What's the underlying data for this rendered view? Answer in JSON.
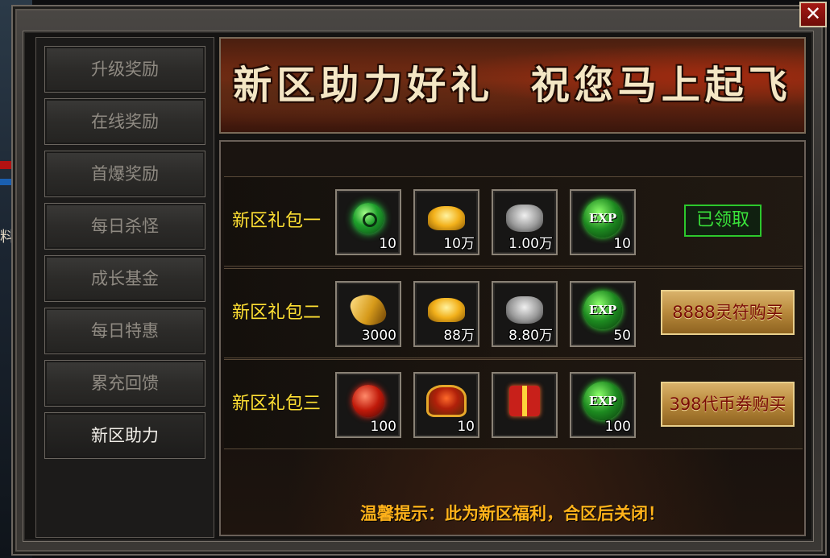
{
  "hud": {
    "left_text": "料"
  },
  "sidebar": {
    "items": [
      {
        "label": "升级奖励",
        "active": false
      },
      {
        "label": "在线奖励",
        "active": false
      },
      {
        "label": "首爆奖励",
        "active": false
      },
      {
        "label": "每日杀怪",
        "active": false
      },
      {
        "label": "成长基金",
        "active": false
      },
      {
        "label": "每日特惠",
        "active": false
      },
      {
        "label": "累充回馈",
        "active": false
      },
      {
        "label": "新区助力",
        "active": true
      }
    ]
  },
  "banner": {
    "title": "新区助力好礼  祝您马上起飞"
  },
  "packs": [
    {
      "name": "新区礼包一",
      "items": [
        {
          "icon": "jade-orb-icon",
          "count": "10"
        },
        {
          "icon": "gold-ingot-icon",
          "count": "10万"
        },
        {
          "icon": "silver-ore-icon",
          "count": "1.00万"
        },
        {
          "icon": "exp-orb-icon",
          "count": "10",
          "text": "EXP"
        }
      ],
      "action": {
        "type": "status",
        "label": "已领取"
      }
    },
    {
      "name": "新区礼包二",
      "items": [
        {
          "icon": "gold-scroll-icon",
          "count": "3000"
        },
        {
          "icon": "gold-ingot-icon",
          "count": "88万"
        },
        {
          "icon": "silver-ore-icon",
          "count": "8.80万"
        },
        {
          "icon": "exp-orb-icon",
          "count": "50",
          "text": "EXP"
        }
      ],
      "action": {
        "type": "button",
        "label": "8888灵符购买"
      }
    },
    {
      "name": "新区礼包三",
      "items": [
        {
          "icon": "red-orb-icon",
          "count": "100"
        },
        {
          "icon": "treasure-chest-icon",
          "count": "10"
        },
        {
          "icon": "gift-box-icon",
          "count": ""
        },
        {
          "icon": "exp-orb-icon",
          "count": "100",
          "text": "EXP"
        }
      ],
      "action": {
        "type": "button",
        "label": "398代币券购买"
      }
    }
  ],
  "tip": "温馨提示：此为新区福利，合区后关闭！",
  "close_label": "✕",
  "colors": {
    "pack_name": "#ffe033",
    "claimed": "#3ae23a",
    "buy_text": "#7a0c06",
    "tip": "#ffb21a"
  }
}
